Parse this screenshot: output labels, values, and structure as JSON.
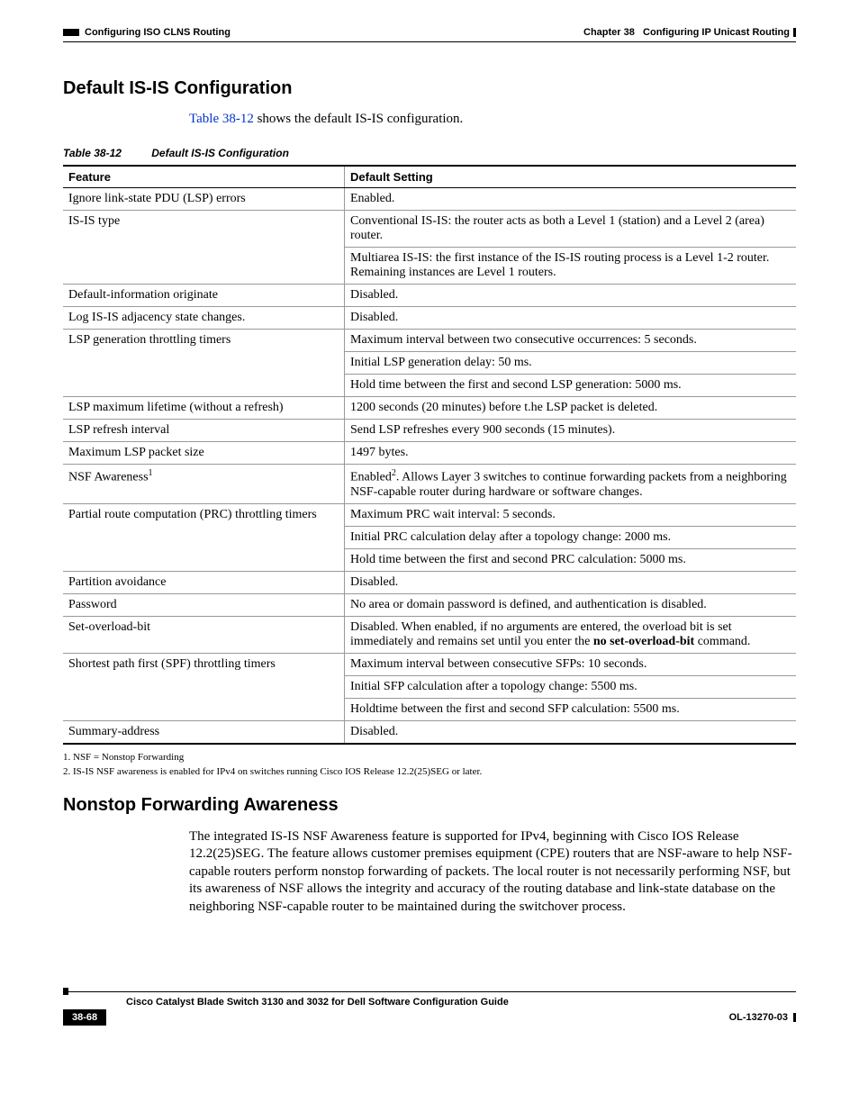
{
  "header": {
    "chapter": "Chapter 38",
    "chapter_title": "Configuring IP Unicast Routing",
    "section": "Configuring ISO CLNS Routing"
  },
  "heading1": "Default IS-IS Configuration",
  "intro": {
    "link": "Table 38-12",
    "rest": " shows the default IS-IS configuration."
  },
  "table": {
    "caption_num": "Table 38-12",
    "caption_title": "Default IS-IS Configuration",
    "col1": "Feature",
    "col2": "Default Setting",
    "rows": {
      "r0": {
        "f": "Ignore link-state PDU (LSP) errors",
        "d": "Enabled."
      },
      "r1": {
        "f": "IS-IS type",
        "d1": "Conventional IS-IS: the router acts as both a Level 1 (station) and a Level 2 (area) router.",
        "d2": "Multiarea IS-IS: the first instance of the IS-IS routing process is a Level 1-2 router. Remaining instances are Level 1 routers."
      },
      "r2": {
        "f": "Default-information originate",
        "d": "Disabled."
      },
      "r3": {
        "f": "Log IS-IS adjacency state changes.",
        "d": "Disabled."
      },
      "r4": {
        "f": "LSP generation throttling timers",
        "d1": "Maximum interval between two consecutive occurrences: 5 seconds.",
        "d2": "Initial LSP generation delay: 50 ms.",
        "d3": "Hold time between the first and second LSP generation: 5000 ms."
      },
      "r5": {
        "f": "LSP maximum lifetime (without a refresh)",
        "d": "1200 seconds (20 minutes) before t.he LSP packet is deleted."
      },
      "r6": {
        "f": "LSP refresh interval",
        "d": "Send LSP refreshes every 900 seconds (15 minutes)."
      },
      "r7": {
        "f": "Maximum LSP packet size",
        "d": "1497 bytes."
      },
      "r8": {
        "f": "NSF Awareness",
        "d_pre": "Enabled",
        "d_post": ". Allows Layer 3 switches to continue forwarding packets from a neighboring NSF-capable router during hardware or software changes."
      },
      "r9": {
        "f": "Partial route computation (PRC) throttling timers",
        "d1": "Maximum PRC wait interval: 5 seconds.",
        "d2": "Initial PRC calculation delay after a topology change: 2000 ms.",
        "d3": "Hold time between the first and second PRC calculation: 5000 ms."
      },
      "r10": {
        "f": "Partition avoidance",
        "d": "Disabled."
      },
      "r11": {
        "f": "Password",
        "d": "No area or domain password is defined, and authentication is disabled."
      },
      "r12": {
        "f": "Set-overload-bit",
        "d_pre": "Disabled. When enabled, if no arguments are entered, the overload bit is set immediately and remains set until you enter the ",
        "d_bold": "no set-overload-bit",
        "d_post": " command."
      },
      "r13": {
        "f": "Shortest path first (SPF) throttling timers",
        "d1": "Maximum interval between consecutive SFPs: 10 seconds.",
        "d2": "Initial SFP calculation after a topology change: 5500 ms.",
        "d3": "Holdtime between the first and second SFP calculation: 5500 ms."
      },
      "r14": {
        "f": "Summary-address",
        "d": "Disabled."
      }
    }
  },
  "footnotes": {
    "n1": "1.   NSF = Nonstop Forwarding",
    "n2": "2.   IS-IS NSF awareness is enabled for IPv4 on switches running Cisco IOS Release 12.2(25)SEG or later."
  },
  "heading2": "Nonstop Forwarding Awareness",
  "para2": "The integrated IS-IS NSF Awareness feature is supported for IPv4, beginning with Cisco IOS Release 12.2(25)SEG. The feature allows customer premises equipment (CPE) routers that are NSF-aware to help NSF-capable routers perform nonstop forwarding of packets. The local router is not necessarily performing NSF, but its awareness of NSF allows the integrity and accuracy of the routing database and link-state database on the neighboring NSF-capable router to be maintained during the switchover process.",
  "footer": {
    "guide": "Cisco Catalyst Blade Switch 3130 and 3032 for Dell Software Configuration Guide",
    "page": "38-68",
    "doc": "OL-13270-03"
  }
}
